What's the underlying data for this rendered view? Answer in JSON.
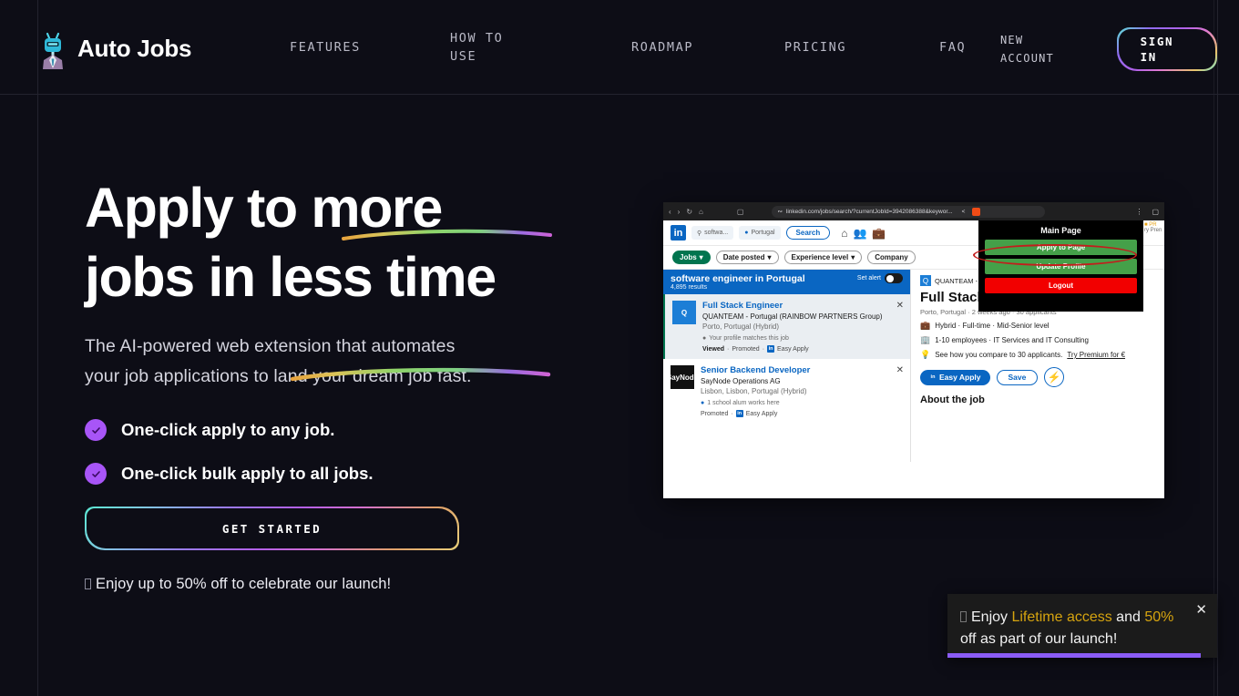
{
  "brand": {
    "name": "Auto Jobs",
    "logo_icon": "robot-in-suit-icon"
  },
  "nav": {
    "items": [
      {
        "label": "FEATURES"
      },
      {
        "label": "HOW TO\nUSE"
      },
      {
        "label": "ROADMAP"
      },
      {
        "label": "PRICING"
      },
      {
        "label": "FAQ"
      },
      {
        "label": "NEW\nACCOUNT"
      }
    ],
    "signin_label": "SIGN\nIN"
  },
  "hero": {
    "headline_line1": "Apply to more",
    "headline_line2": "jobs in less time",
    "underline_word1": "more",
    "underline_word2": "less time",
    "subhead": "The AI-powered web extension that automates your job applications to land your dream job fast.",
    "features": [
      {
        "label": "One-click apply to any job.",
        "icon": "check-circle-icon"
      },
      {
        "label": "One-click bulk apply to all jobs.",
        "icon": "check-circle-icon"
      }
    ],
    "cta_label": "GET STARTED",
    "promo": "Enjoy up to 50% off to celebrate our launch!"
  },
  "toast": {
    "text_1": "Enjoy ",
    "highlight_1": "Lifetime access",
    "text_2": " and ",
    "highlight_2": "50%",
    "text_3": " off as part of our launch!",
    "close_icon": "close-icon",
    "progress_percent": 94,
    "accent_color": "#8b5cf6",
    "highlight_color": "#d6a40f"
  },
  "mockup": {
    "browser": {
      "url": "linkedin.com/jobs/search/?currentJobId=3942086388&keywor...",
      "back_icon": "chevron-left-icon",
      "forward_icon": "chevron-right-icon",
      "reload_icon": "reload-icon",
      "home_icon": "home-icon",
      "bookmark_icon": "bookmark-icon",
      "share_icon": "share-icon",
      "shield_icon": "brave-shield-icon",
      "menu_icon": "kebab-menu-icon",
      "window_icon": "window-icon"
    },
    "linkedin": {
      "logo": "in",
      "search_value": "softwa...",
      "location_value": "Portugal",
      "search_button": "Search",
      "nav_icons": [
        "home-icon",
        "network-icon",
        "jobs-icon"
      ],
      "filters": [
        {
          "label": "Jobs",
          "active": true
        },
        {
          "label": "Date posted",
          "active": false
        },
        {
          "label": "Experience level",
          "active": false
        },
        {
          "label": "Company",
          "active": false
        }
      ],
      "results_header": {
        "query": "software engineer in Portugal",
        "count": "4,895 results",
        "alert_label": "Set alert"
      },
      "jobs": [
        {
          "title": "Full Stack Engineer",
          "company": "QUANTEAM - Portugal (RAINBOW PARTNERS Group)",
          "location": "Porto, Portugal (Hybrid)",
          "insight": "Your profile matches this job",
          "footer_viewed": "Viewed",
          "footer_promoted": "Promoted",
          "footer_apply": "Easy Apply",
          "logo_text": "Q",
          "selected": true
        },
        {
          "title": "Senior Backend Developer",
          "company": "SayNode Operations AG",
          "location": "Lisbon, Lisbon, Portugal (Hybrid)",
          "insight": "1 school alum works here",
          "footer_promoted": "Promoted",
          "footer_apply": "Easy Apply",
          "logo_text": "SayNode",
          "selected": false
        }
      ],
      "detail": {
        "company_line": "QUANTEAM - Portugal (RAINBOW PARTNERS Group)",
        "title": "Full Stack Engineer",
        "meta": "Porto, Portugal · 2 weeks ago · 30 applicants",
        "row_workplace": "Hybrid · Full-time · Mid-Senior level",
        "row_company": "1-10 employees · IT Services and IT Consulting",
        "row_premium": "See how you compare to 30 applicants.",
        "row_premium_link": "Try Premium for €",
        "btn_apply": "Easy Apply",
        "btn_save": "Save",
        "btn_bolt_icon": "lightning-bolt-icon",
        "about_heading": "About the job"
      }
    },
    "extension_popup": {
      "title": "Main Page",
      "buttons": [
        {
          "label": "Apply to Page",
          "style": "green",
          "annotated": true
        },
        {
          "label": "Update Profile",
          "style": "green",
          "annotated": false
        },
        {
          "label": "Logout",
          "style": "red",
          "annotated": false
        }
      ],
      "annotation_color": "#c31d1d"
    }
  }
}
